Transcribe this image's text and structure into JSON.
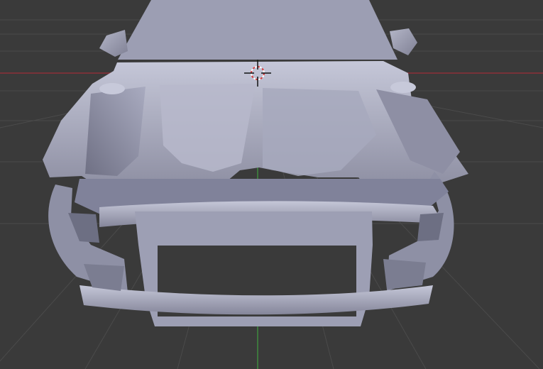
{
  "viewport": {
    "background_color": "#3a3a3a",
    "grid_color": "#4b4b4b",
    "x_axis_color": "#8c2f39",
    "y_axis_color": "#3f8f3f",
    "model_color": "#9a9bb0",
    "model_shadow_color": "#5d5e72",
    "model_highlight_color": "#c4c6d8",
    "cursor_ring_colors": [
      "#d83a3a",
      "#ffffff"
    ]
  },
  "icons": {
    "cursor": "3d-cursor-icon"
  }
}
